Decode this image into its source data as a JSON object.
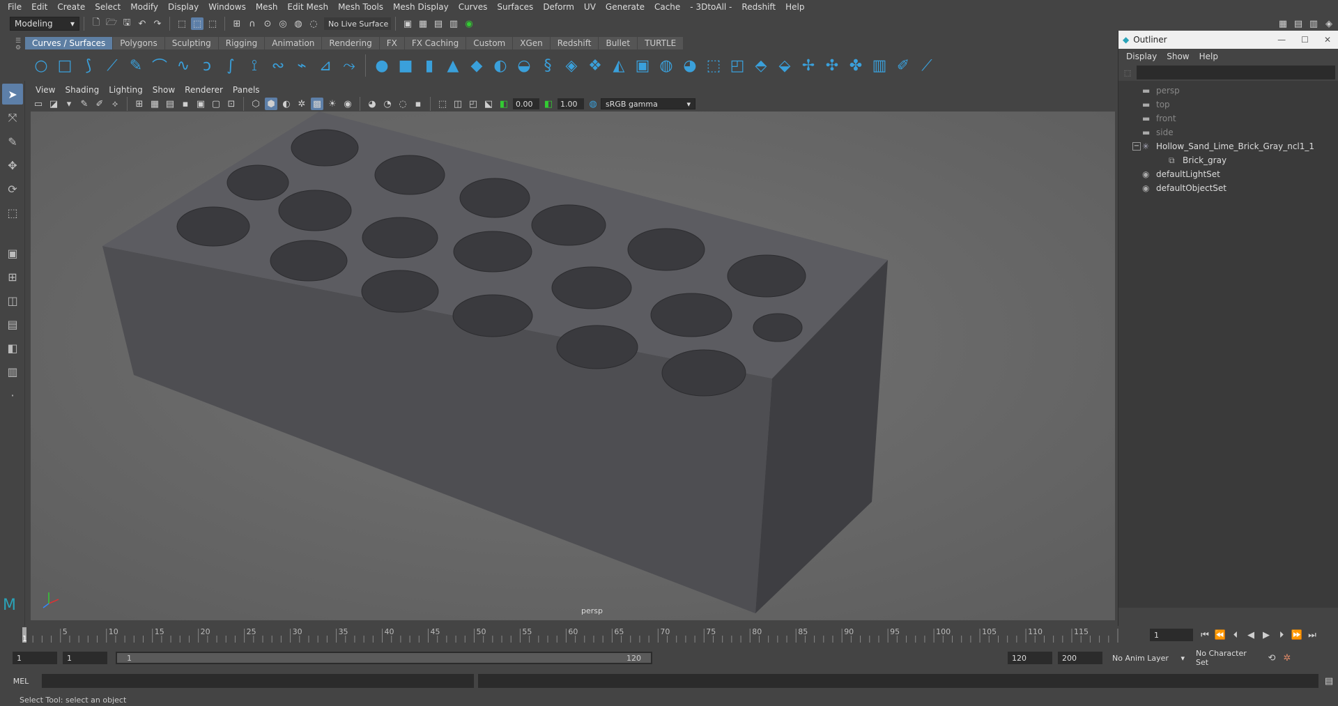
{
  "menubar": [
    "File",
    "Edit",
    "Create",
    "Select",
    "Modify",
    "Display",
    "Windows",
    "Mesh",
    "Edit Mesh",
    "Mesh Tools",
    "Mesh Display",
    "Curves",
    "Surfaces",
    "Deform",
    "UV",
    "Generate",
    "Cache",
    "- 3DtoAll -",
    "Redshift",
    "Help"
  ],
  "statusline": {
    "mode": "Modeling",
    "live_surface": "No Live Surface"
  },
  "shelf_tabs": [
    "Curves / Surfaces",
    "Polygons",
    "Sculpting",
    "Rigging",
    "Animation",
    "Rendering",
    "FX",
    "FX Caching",
    "Custom",
    "XGen",
    "Redshift",
    "Bullet",
    "TURTLE"
  ],
  "shelf_active": "Curves / Surfaces",
  "viewport": {
    "menu": [
      "View",
      "Shading",
      "Lighting",
      "Show",
      "Renderer",
      "Panels"
    ],
    "exposure": "0.00",
    "gamma": "1.00",
    "color_space": "sRGB gamma",
    "camera_label": "persp"
  },
  "outliner": {
    "title": "Outliner",
    "menu": [
      "Display",
      "Show",
      "Help"
    ],
    "items": [
      {
        "label": "persp",
        "icon": "camera-icon",
        "dim": true,
        "indent": 0
      },
      {
        "label": "top",
        "icon": "camera-icon",
        "dim": true,
        "indent": 0
      },
      {
        "label": "front",
        "icon": "camera-icon",
        "dim": true,
        "indent": 0
      },
      {
        "label": "side",
        "icon": "camera-icon",
        "dim": true,
        "indent": 0
      },
      {
        "label": "Hollow_Sand_Lime_Brick_Gray_ncl1_1",
        "icon": "group-icon",
        "dim": false,
        "indent": 0,
        "expand": "−"
      },
      {
        "label": "Brick_gray",
        "icon": "mesh-icon",
        "dim": false,
        "indent": 1
      },
      {
        "label": "defaultLightSet",
        "icon": "set-icon",
        "dim": false,
        "indent": 0
      },
      {
        "label": "defaultObjectSet",
        "icon": "set-icon",
        "dim": false,
        "indent": 0
      }
    ]
  },
  "timeline": {
    "ticks": [
      "5",
      "10",
      "15",
      "20",
      "25",
      "30",
      "35",
      "40",
      "45",
      "50",
      "55",
      "60",
      "65",
      "70",
      "75",
      "80",
      "85",
      "90",
      "95",
      "100",
      "105",
      "110",
      "115"
    ],
    "start_label": "1",
    "current_frame": "1"
  },
  "range": {
    "start": "1",
    "playback_start": "1",
    "slider_start": "1",
    "slider_end": "120",
    "playback_end": "120",
    "end": "200",
    "anim_layer": "No Anim Layer",
    "character_set": "No Character Set"
  },
  "command": {
    "language": "MEL"
  },
  "help_line": "Select Tool: select an object"
}
